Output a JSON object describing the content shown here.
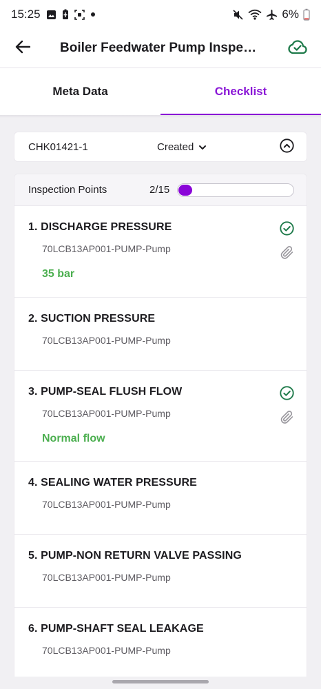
{
  "status_bar": {
    "time": "15:25",
    "battery_percent": "6%",
    "left_icons": [
      "image-icon",
      "battery-saver-icon",
      "screenshot-icon",
      "dot-icon"
    ],
    "right_icons": [
      "mute-icon",
      "wifi-icon",
      "airplane-icon",
      "battery-icon"
    ]
  },
  "app_bar": {
    "title": "Boiler Feedwater Pump Inspe…",
    "back_icon": "arrow-left-icon",
    "sync_icon": "cloud-check-icon"
  },
  "tabs": [
    {
      "label": "Meta Data",
      "active": false
    },
    {
      "label": "Checklist",
      "active": true
    }
  ],
  "checklist_header": {
    "id": "CHK01421-1",
    "status": "Created",
    "toggle_icon": "chevron-up-circle-icon"
  },
  "inspection": {
    "label": "Inspection Points",
    "count": "2/15",
    "progress_fraction": 0.133
  },
  "items": [
    {
      "title": "1. DISCHARGE PRESSURE",
      "subtitle": "70LCB13AP001-PUMP-Pump",
      "value": "35 bar",
      "checked": true
    },
    {
      "title": "2. SUCTION PRESSURE",
      "subtitle": "70LCB13AP001-PUMP-Pump",
      "value": "",
      "checked": false
    },
    {
      "title": "3. PUMP-SEAL FLUSH FLOW",
      "subtitle": "70LCB13AP001-PUMP-Pump",
      "value": "Normal flow",
      "checked": true
    },
    {
      "title": "4. SEALING WATER PRESSURE",
      "subtitle": "70LCB13AP001-PUMP-Pump",
      "value": "",
      "checked": false
    },
    {
      "title": "5. PUMP-NON RETURN VALVE PASSING",
      "subtitle": "70LCB13AP001-PUMP-Pump",
      "value": "",
      "checked": false
    },
    {
      "title": "6. PUMP-SHAFT SEAL LEAKAGE",
      "subtitle": "70LCB13AP001-PUMP-Pump",
      "value": "",
      "checked": false
    }
  ],
  "colors": {
    "accent": "#8a17d6",
    "progress": "#8a05d8",
    "success": "#4caf50",
    "check_icon": "#1e7a4a",
    "sync_icon": "#1e7a4a"
  }
}
